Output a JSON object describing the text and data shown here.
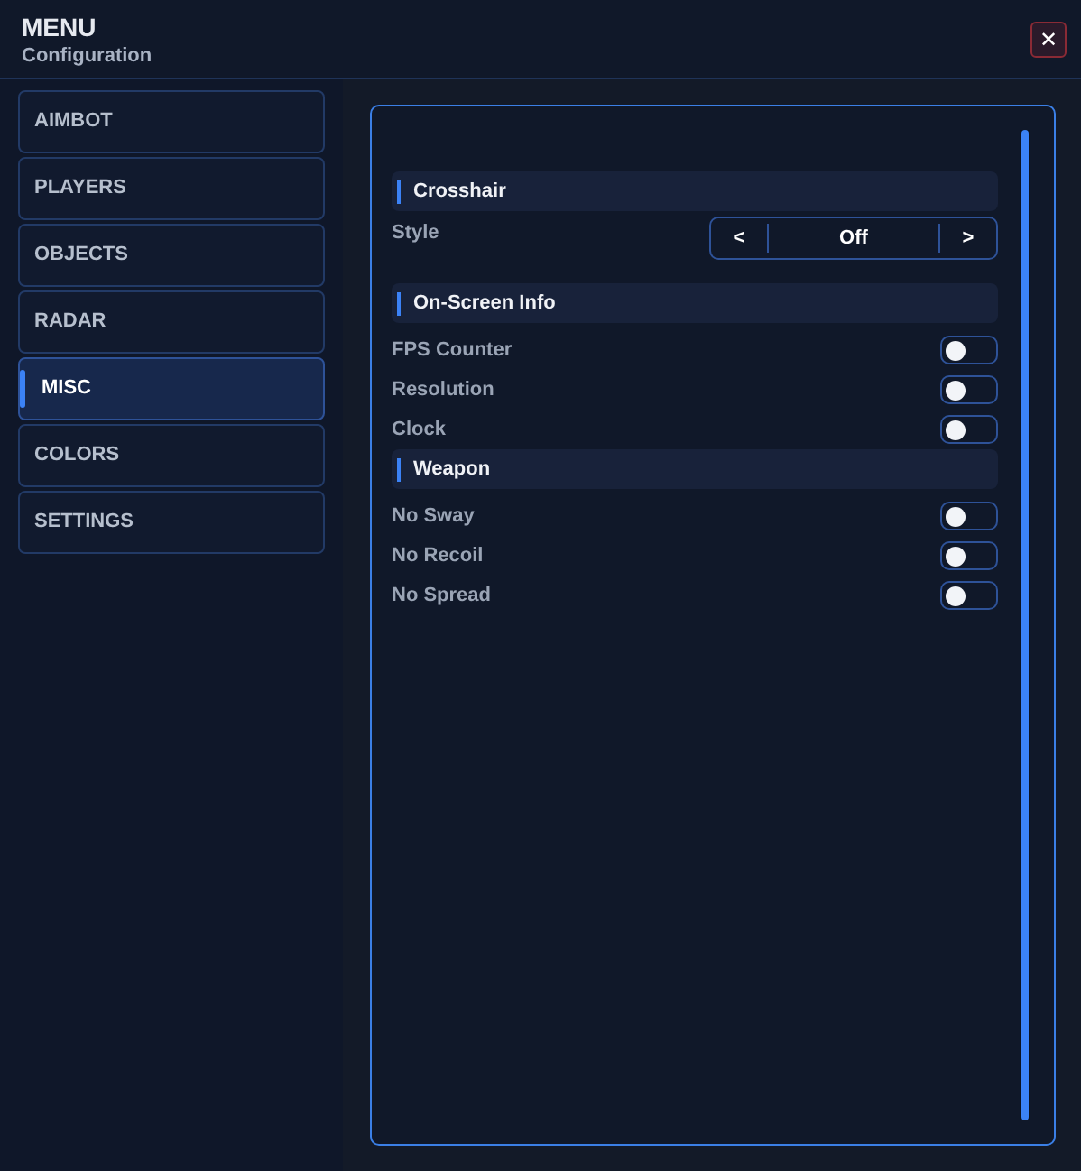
{
  "window": {
    "title": "MENU",
    "subtitle": "Configuration",
    "close": "✕"
  },
  "sidebar": {
    "items": [
      {
        "label": "AIMBOT",
        "selected": false
      },
      {
        "label": "PLAYERS",
        "selected": false
      },
      {
        "label": "OBJECTS",
        "selected": false
      },
      {
        "label": "RADAR",
        "selected": false
      },
      {
        "label": "MISC",
        "selected": true
      },
      {
        "label": "COLORS",
        "selected": false
      },
      {
        "label": "SETTINGS",
        "selected": false
      }
    ]
  },
  "settings": [
    {
      "kind": "header",
      "label": "Crosshair"
    },
    {
      "kind": "selector",
      "label": "Style",
      "prev": "<",
      "value": "Off",
      "next": ">"
    },
    {
      "kind": "header",
      "label": "On-Screen Info"
    },
    {
      "kind": "toggle",
      "label": "FPS Counter",
      "on": false
    },
    {
      "kind": "toggle",
      "label": "Resolution",
      "on": false
    },
    {
      "kind": "toggle",
      "label": "Clock",
      "on": false
    },
    {
      "kind": "header",
      "label": "Weapon"
    },
    {
      "kind": "toggle",
      "label": "No Sway",
      "on": false
    },
    {
      "kind": "toggle",
      "label": "No Recoil",
      "on": false
    },
    {
      "kind": "toggle",
      "label": "No Spread",
      "on": false
    }
  ]
}
